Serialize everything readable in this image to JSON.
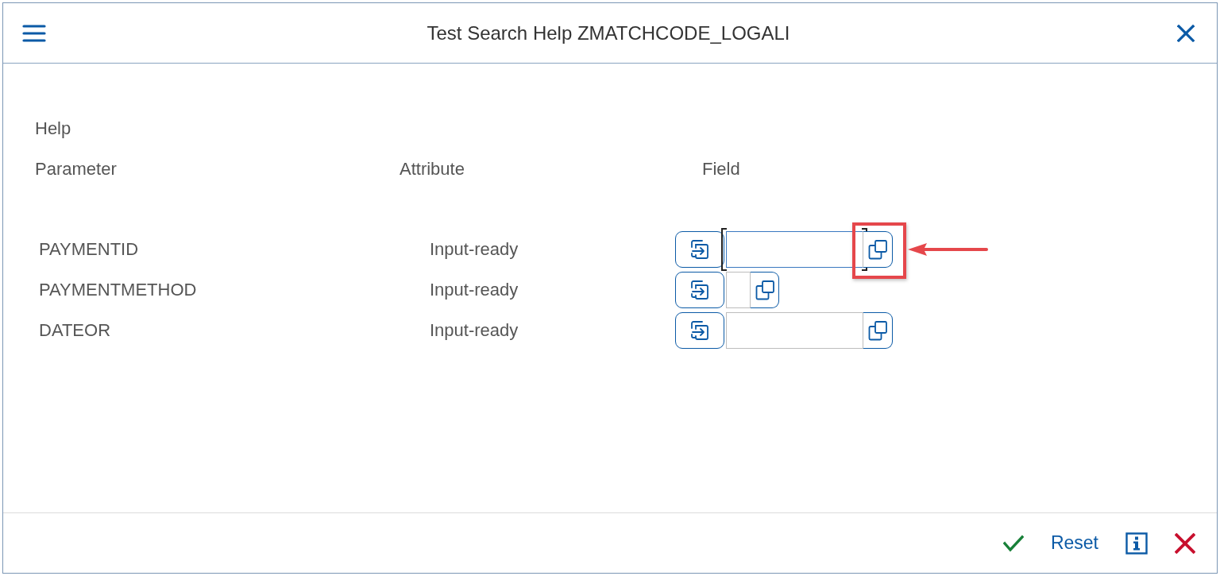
{
  "dialog": {
    "title": "Test Search Help ZMATCHCODE_LOGALI"
  },
  "section_label": "Help",
  "columns": [
    "Parameter",
    "Attribute",
    "Field"
  ],
  "parameters": [
    {
      "name": "PAYMENTID",
      "attribute": "Input-ready",
      "kind": "wide",
      "focused": true,
      "highlighted": true
    },
    {
      "name": "PAYMENTMETHOD",
      "attribute": "Input-ready",
      "kind": "narrow",
      "focused": false,
      "highlighted": false
    },
    {
      "name": "DATEOR",
      "attribute": "Input-ready",
      "kind": "wide",
      "focused": false,
      "highlighted": false
    }
  ],
  "footer": {
    "buttons": [
      {
        "kind": "confirm"
      },
      {
        "kind": "reset",
        "label": "Reset"
      },
      {
        "kind": "info"
      },
      {
        "kind": "cancel"
      }
    ]
  }
}
